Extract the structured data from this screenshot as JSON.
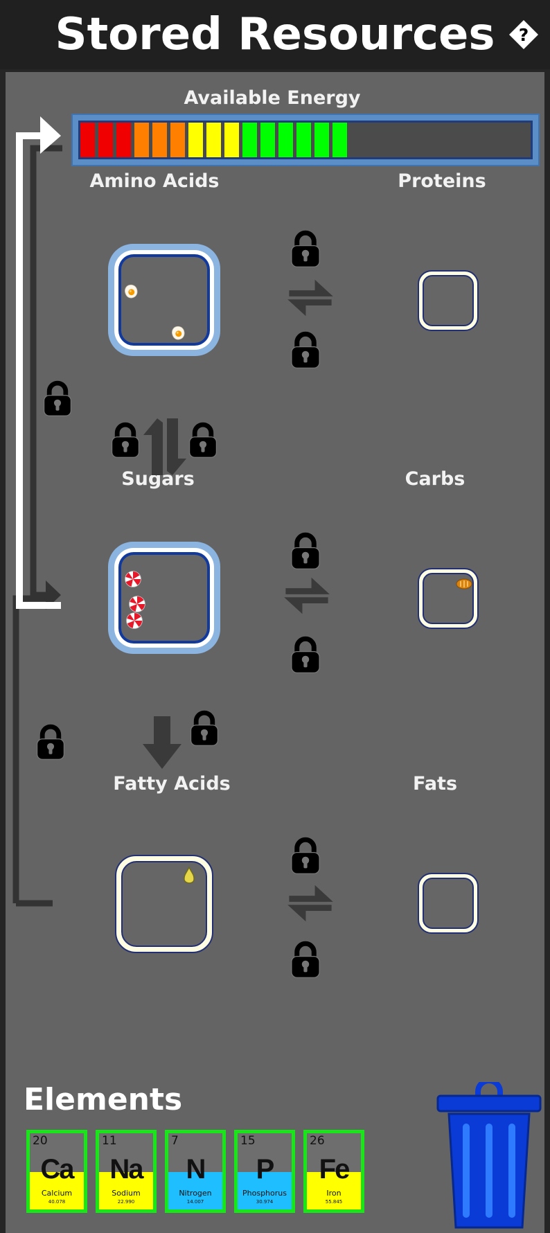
{
  "header": {
    "title": "Stored Resources",
    "help_icon": "question-diamond-icon"
  },
  "energy": {
    "label": "Available Energy",
    "level": 0.6,
    "segments": [
      "#f00000",
      "#f00000",
      "#f00000",
      "#ff8000",
      "#ff8000",
      "#ff8000",
      "#ffff00",
      "#ffff00",
      "#ffff00",
      "#00ff00",
      "#00ff00",
      "#00ff00",
      "#00ff00",
      "#00ff00",
      "#00ff00"
    ]
  },
  "compounds": {
    "amino_acids": {
      "label": "Amino Acids",
      "icon": "egg-icon",
      "count": 2
    },
    "proteins": {
      "label": "Proteins",
      "count": 0
    },
    "sugars": {
      "label": "Sugars",
      "icon": "peppermint-candy-icon",
      "count": 3
    },
    "carbs": {
      "label": "Carbs",
      "icon": "bread-icon",
      "count": 1
    },
    "fatty_acids": {
      "label": "Fatty Acids",
      "icon": "oil-drop-icon",
      "count": 1
    },
    "fats": {
      "label": "Fats",
      "count": 0
    }
  },
  "locks": {
    "icon": "padlock-icon",
    "state": "locked"
  },
  "elements": {
    "title": "Elements",
    "items": [
      {
        "number": "20",
        "symbol": "Ca",
        "name": "Calcium",
        "mass": "40.078",
        "color": "#ffff00"
      },
      {
        "number": "11",
        "symbol": "Na",
        "name": "Sodium",
        "mass": "22.990",
        "color": "#ffff00"
      },
      {
        "number": "7",
        "symbol": "N",
        "name": "Nitrogen",
        "mass": "14.007",
        "color": "#1fbfff"
      },
      {
        "number": "15",
        "symbol": "P",
        "name": "Phosphorus",
        "mass": "30.974",
        "color": "#1fbfff"
      },
      {
        "number": "26",
        "symbol": "Fe",
        "name": "Iron",
        "mass": "55.845",
        "color": "#ffff00"
      }
    ]
  },
  "trash": {
    "icon": "trash-can-icon"
  }
}
